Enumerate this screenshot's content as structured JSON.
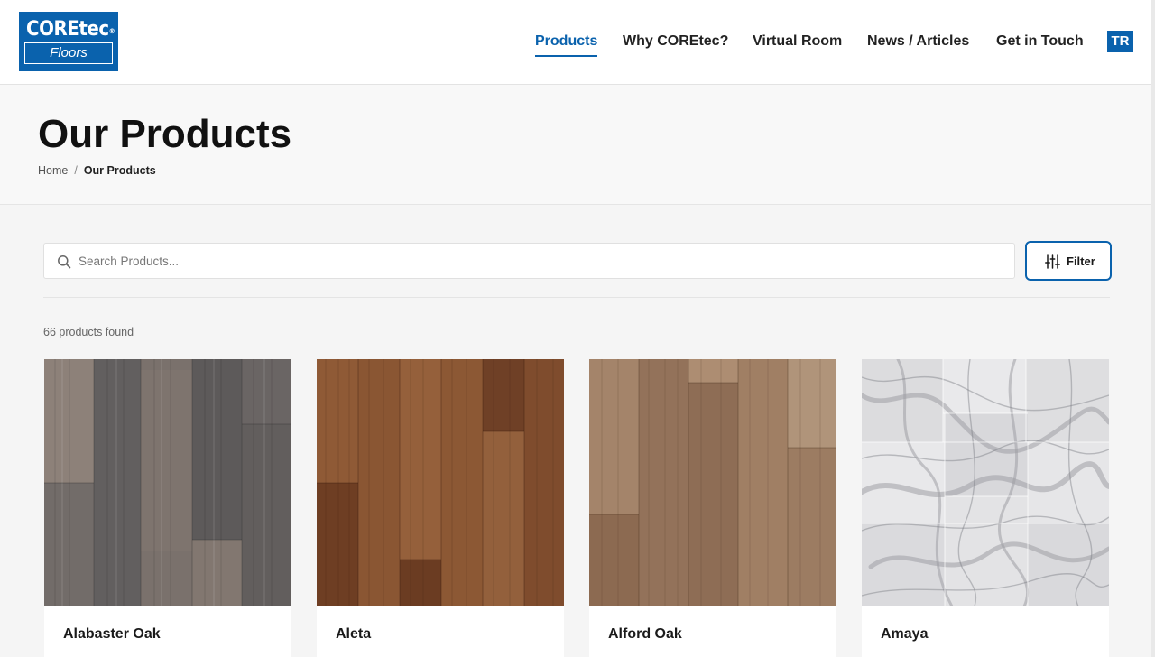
{
  "brand": {
    "logo_top": "COREtec",
    "logo_reg": "®",
    "logo_bottom": "Floors"
  },
  "nav": {
    "items": [
      {
        "label": "Products",
        "active": true
      },
      {
        "label": "Why COREtec?"
      },
      {
        "label": "Virtual Room"
      },
      {
        "label": "News / Articles"
      },
      {
        "label": "Get in Touch"
      }
    ],
    "language": "TR"
  },
  "page": {
    "title": "Our Products",
    "breadcrumb": {
      "home": "Home",
      "separator": "/",
      "current": "Our Products"
    }
  },
  "search": {
    "placeholder": "Search Products...",
    "value": ""
  },
  "filter": {
    "label": "Filter"
  },
  "results": {
    "count_text": "66 products found"
  },
  "products": [
    {
      "name": "Alabaster Oak",
      "swatch": "grey-oak"
    },
    {
      "name": "Aleta",
      "swatch": "brown-wood"
    },
    {
      "name": "Alford Oak",
      "swatch": "light-brown-oak"
    },
    {
      "name": "Amaya",
      "swatch": "white-marble"
    }
  ],
  "colors": {
    "brand_blue": "#0a62ad"
  }
}
